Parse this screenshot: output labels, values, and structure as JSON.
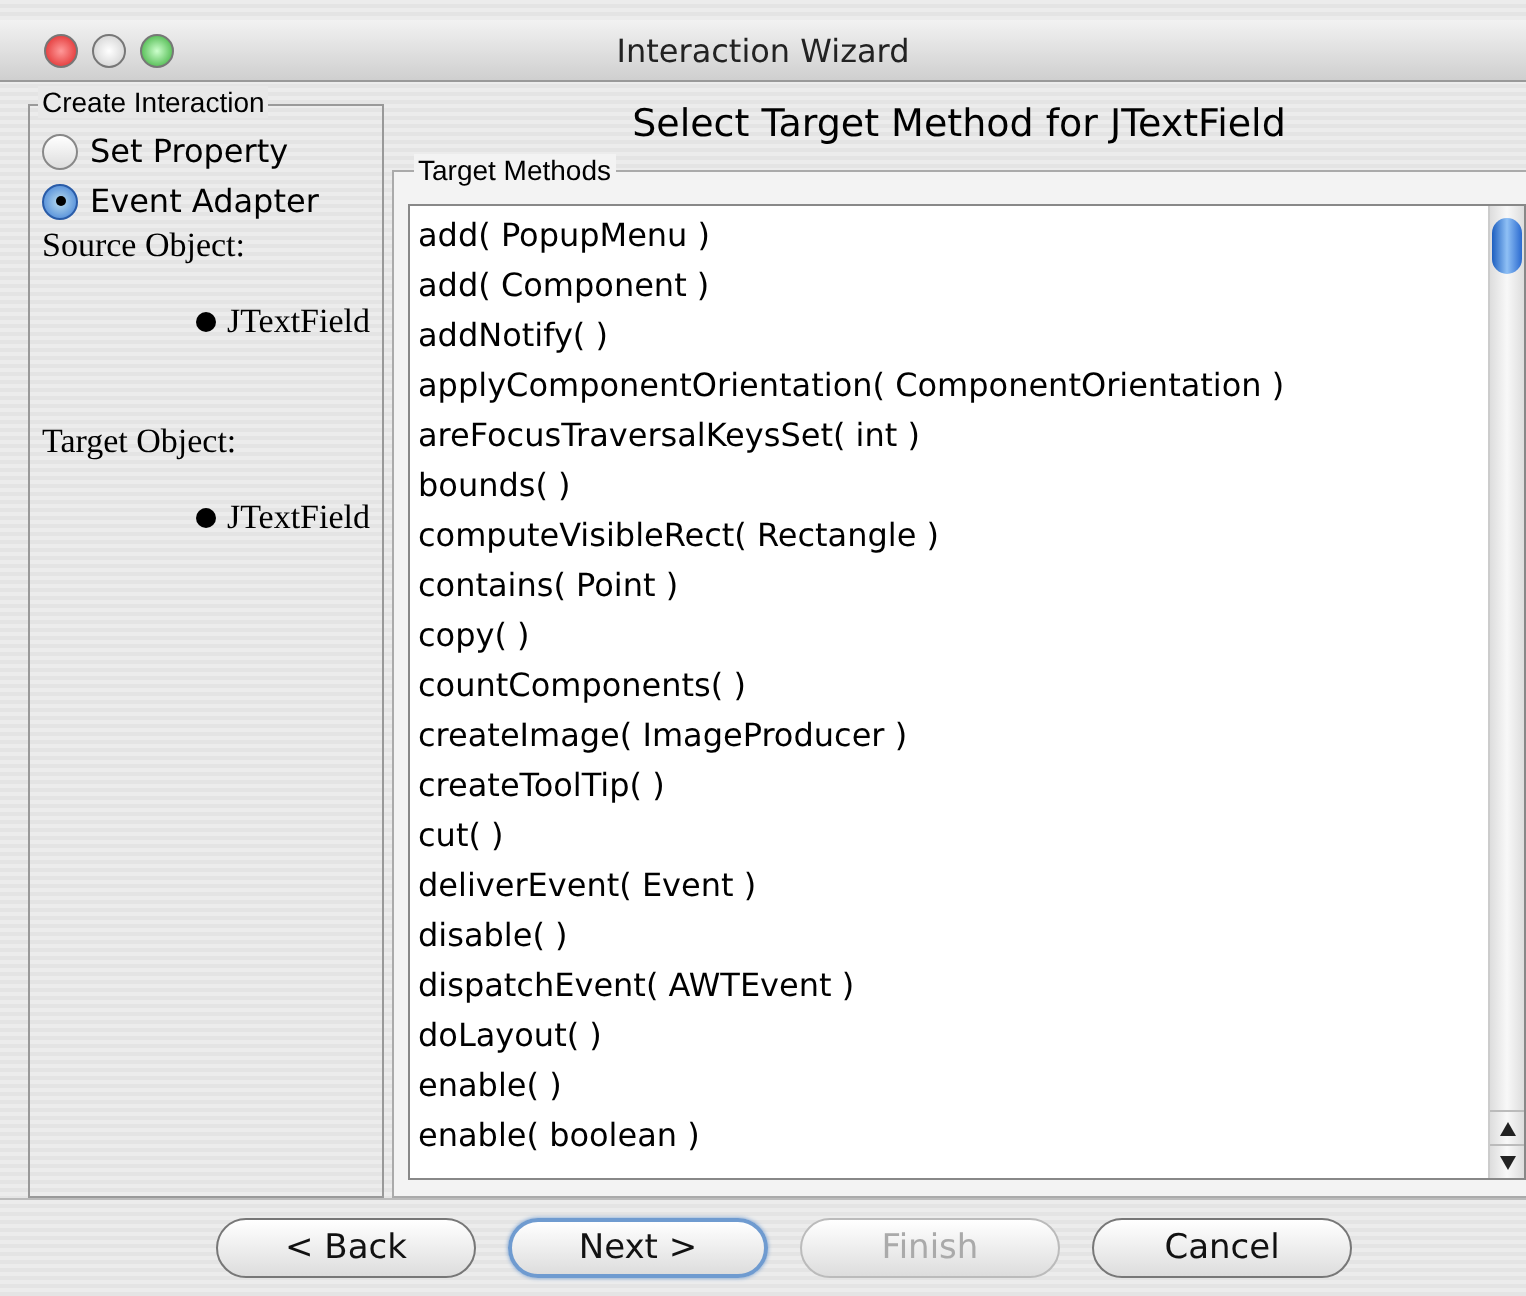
{
  "window": {
    "title": "Interaction Wizard"
  },
  "create_interaction": {
    "title": "Create Interaction",
    "options": [
      {
        "label": "Set Property",
        "selected": false
      },
      {
        "label": "Event Adapter",
        "selected": true
      }
    ],
    "source_label": "Source Object:",
    "source_value": "JTextField",
    "target_label": "Target Object:",
    "target_value": "JTextField"
  },
  "heading": "Select Target Method for JTextField",
  "target_methods": {
    "title": "Target Methods",
    "items": [
      "add( PopupMenu  )",
      "add( Component  )",
      "addNotify( )",
      "applyComponentOrientation( ComponentOrientation  )",
      "areFocusTraversalKeysSet( int  )",
      "bounds( )",
      "computeVisibleRect( Rectangle  )",
      "contains( Point  )",
      "copy( )",
      "countComponents( )",
      "createImage( ImageProducer  )",
      "createToolTip( )",
      "cut( )",
      "deliverEvent( Event  )",
      "disable( )",
      "dispatchEvent( AWTEvent  )",
      "doLayout( )",
      "enable( )",
      "enable( boolean  )"
    ]
  },
  "buttons": [
    {
      "label": "< Back",
      "disabled": false,
      "default": false
    },
    {
      "label": "Next >",
      "disabled": false,
      "default": true
    },
    {
      "label": "Finish",
      "disabled": true,
      "default": false
    },
    {
      "label": "Cancel",
      "disabled": false,
      "default": false
    }
  ]
}
